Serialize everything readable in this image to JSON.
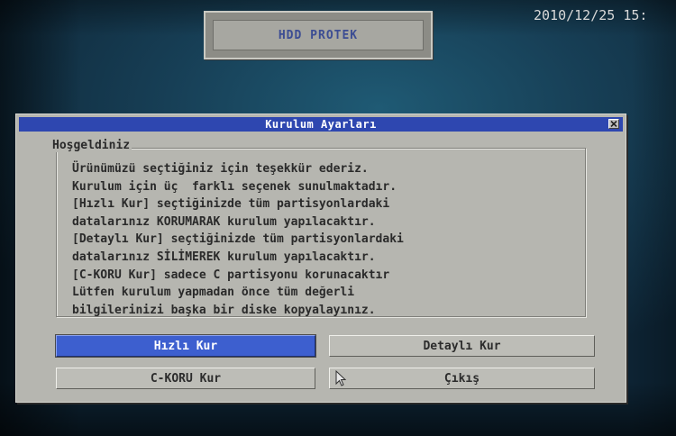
{
  "header": {
    "brand": "HDD PROTEK",
    "datetime": "2010/12/25 15:"
  },
  "dialog": {
    "title": "Kurulum Ayarları",
    "group_title": "Hoşgeldiniz",
    "message_lines": [
      "Ürünümüzü seçtiğiniz için teşekkür ederiz.",
      "Kurulum için üç  farklı seçenek sunulmaktadır.",
      "[Hızlı Kur] seçtiğinizde tüm partisyonlardaki",
      "datalarınız KORUMARAK kurulum yapılacaktır.",
      "[Detaylı Kur] seçtiğinizde tüm partisyonlardaki",
      "datalarınız SİLİMEREK kurulum yapılacaktır.",
      "[C-KORU Kur] sadece C partisyonu korunacaktır",
      "Lütfen kurulum yapmadan önce tüm değerli",
      "bilgilerinizi başka bir diske kopyalayınız."
    ],
    "buttons": {
      "hizli": "Hızlı Kur",
      "detayli": "Detaylı Kur",
      "cko": "C-KORU Kur",
      "cikis": "Çıkış"
    },
    "selected_button": "Hızlı Kur"
  },
  "colors": {
    "titlebar": "#2e47b0",
    "dialog_bg": "#b6b6b0",
    "selected_button": "#3d5fcf",
    "brand_text": "#3c4d93"
  }
}
